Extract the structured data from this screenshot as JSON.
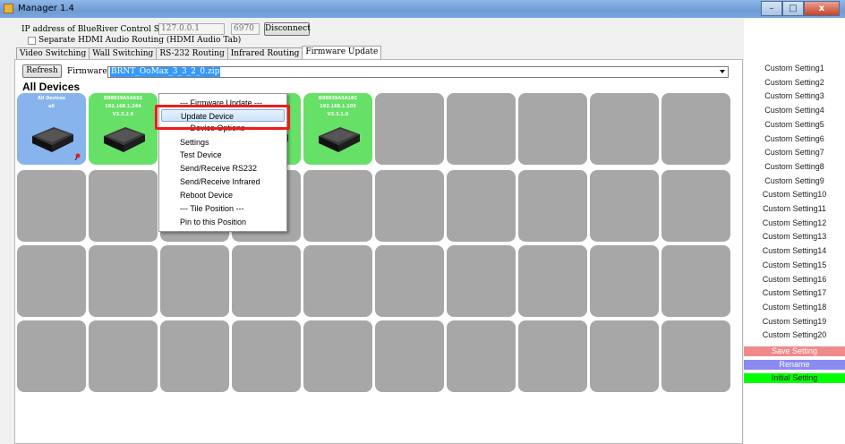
{
  "window": {
    "title": "Manager 1.4",
    "min": "–",
    "max": "□",
    "close": "x"
  },
  "conn": {
    "label": "IP address of BlueRiver Control Server",
    "ip": "127.0.0.1",
    "port": "6970",
    "disconnect": "Disconnect"
  },
  "separate_hdmi": {
    "label": "Separate HDMI Audio Routing (HDMI Audio Tab)"
  },
  "tabs": [
    "Video Switching",
    "Wall Switching",
    "RS-232 Routing",
    "Infrared Routing",
    "Firmware Update"
  ],
  "firmware": {
    "refresh": "Refresh",
    "file_label": "Firmware File",
    "file_value": "BRNT_OoMax_3_3_2_0.zip"
  },
  "all_devices_heading": "All Devices",
  "tiles": [
    {
      "color": "blue",
      "name": "All Devices",
      "ip": "all",
      "ver": "",
      "pinned": true
    },
    {
      "color": "green",
      "name": "D88039A5A6S2",
      "ip": "192.168.1.244",
      "ver": "V3.3.2.6",
      "pinned": false
    },
    {
      "color": "green",
      "name": "",
      "ip": "",
      "ver": "",
      "pinned": false
    },
    {
      "color": "green",
      "name": "",
      "ip": "",
      "ver": "",
      "pinned": false
    },
    {
      "color": "green",
      "name": "D88039A5A16C",
      "ip": "192.168.1.103",
      "ver": "V3.3.1.0",
      "pinned": false
    }
  ],
  "context_menu": {
    "items": [
      "--- Firmware Update ---",
      "Update Device",
      "--- Device Options ---",
      "Settings",
      "Test Device",
      "Send/Receive RS232",
      "Send/Receive Infrared",
      "Reboot Device",
      "--- Tile Position ---",
      "Pin to this Position"
    ],
    "highlighted": "Update Device"
  },
  "custom_settings": [
    "Custom Setting1",
    "Custom Setting2",
    "Custom Setting3",
    "Custom Setting4",
    "Custom Setting5",
    "Custom Setting6",
    "Custom Setting7",
    "Custom Setting8",
    "Custom Setting9",
    "Custom Setting10",
    "Custom Setting11",
    "Custom Setting12",
    "Custom Setting13",
    "Custom Setting14",
    "Custom Setting15",
    "Custom Setting16",
    "Custom Setting17",
    "Custom Setting18",
    "Custom Setting19",
    "Custom Setting20"
  ],
  "actions": {
    "save": "Save Setting",
    "rename": "Rename",
    "initial": "Initial Setting"
  },
  "colors": {
    "tile_green": "#67e067",
    "tile_blue": "#88b4ee",
    "tile_gray": "#a7a7a7",
    "save": "#f08a8a",
    "rename": "#8a8af0",
    "initial": "#00ff00",
    "highlight_border": "#ee1c1c"
  }
}
